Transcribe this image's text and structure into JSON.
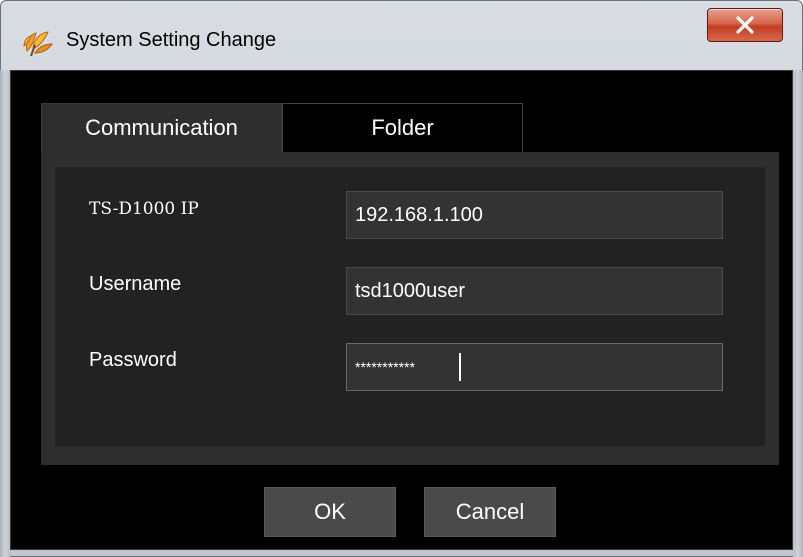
{
  "window": {
    "title": "System Setting Change",
    "app_icon": "leaf-icon",
    "close_icon": "close-icon"
  },
  "tabs": [
    {
      "label": "Communication",
      "selected": true
    },
    {
      "label": "Folder",
      "selected": false
    }
  ],
  "form": {
    "ip": {
      "label": "TS-D1000 IP",
      "value": "192.168.1.100"
    },
    "username": {
      "label": "Username",
      "value": "tsd1000user"
    },
    "password": {
      "label": "Password",
      "value": "***********"
    }
  },
  "buttons": {
    "ok_label": "OK",
    "cancel_label": "Cancel"
  },
  "colors": {
    "client_background": "#000000",
    "panel": "#2e2e2e",
    "panel_inner": "#222222",
    "input_background": "#333333",
    "button": "#4a4a4a",
    "close_button": "#c23d22"
  }
}
